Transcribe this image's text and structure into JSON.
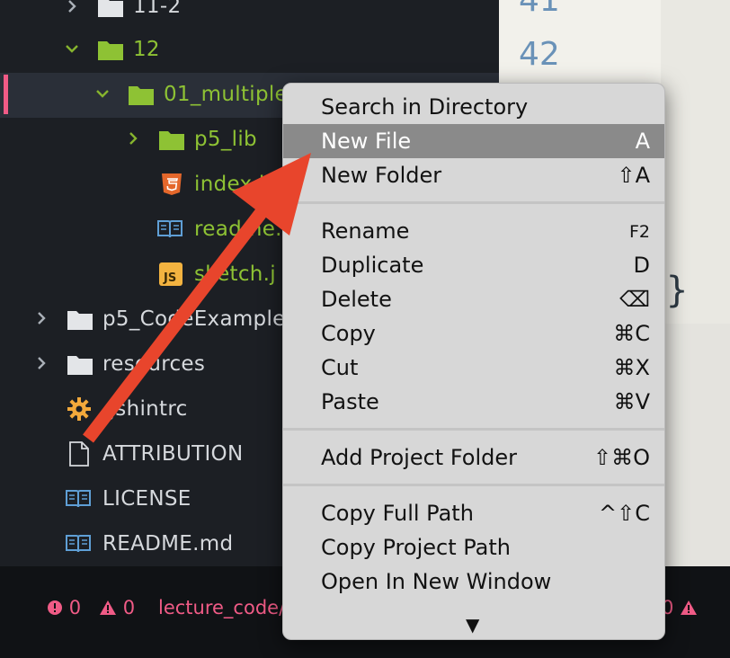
{
  "tree": {
    "items": [
      {
        "label": "11-2",
        "color": "gray"
      },
      {
        "label": "12",
        "color": "green"
      },
      {
        "label": "01_multiple",
        "color": "green"
      },
      {
        "label": "p5_lib",
        "color": "green"
      },
      {
        "label": "index.h",
        "color": "green"
      },
      {
        "label": "readme.",
        "color": "green"
      },
      {
        "label": "sketch.j",
        "color": "green"
      },
      {
        "label": "p5_CodeExample",
        "color": "gray"
      },
      {
        "label": "resources",
        "color": "gray"
      },
      {
        "label": ".jshintrc",
        "color": "gray"
      },
      {
        "label": "ATTRIBUTION",
        "color": "gray"
      },
      {
        "label": "LICENSE",
        "color": "gray"
      },
      {
        "label": "README.md",
        "color": "gray"
      }
    ]
  },
  "editor": {
    "line_numbers": [
      "41",
      "42"
    ],
    "brace": "}"
  },
  "status": {
    "errors": "0",
    "warnings": "0",
    "path": "lecture_code/",
    "right_errors": "0"
  },
  "menu": {
    "groups": [
      [
        {
          "label": "Search in Directory",
          "shortcut": ""
        },
        {
          "label": "New File",
          "shortcut": "A",
          "highlighted": true
        },
        {
          "label": "New Folder",
          "shortcut": "⇧A"
        }
      ],
      [
        {
          "label": "Rename",
          "shortcut": "F2"
        },
        {
          "label": "Duplicate",
          "shortcut": "D"
        },
        {
          "label": "Delete",
          "shortcut": "⌫"
        },
        {
          "label": "Copy",
          "shortcut": "⌘C"
        },
        {
          "label": "Cut",
          "shortcut": "⌘X"
        },
        {
          "label": "Paste",
          "shortcut": "⌘V"
        }
      ],
      [
        {
          "label": "Add Project Folder",
          "shortcut": "⇧⌘O"
        }
      ],
      [
        {
          "label": "Copy Full Path",
          "shortcut": "^⇧C"
        },
        {
          "label": "Copy Project Path",
          "shortcut": ""
        },
        {
          "label": "Open In New Window",
          "shortcut": ""
        }
      ]
    ],
    "more_indicator": "▼"
  },
  "colors": {
    "accent": "#f05b86",
    "folder_green": "#8ec234",
    "annotation_arrow": "#e8452c"
  }
}
